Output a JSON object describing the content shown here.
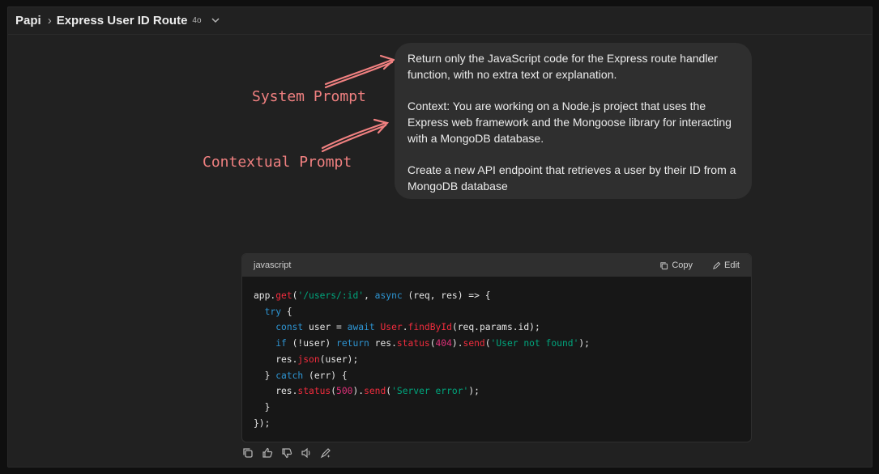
{
  "header": {
    "workspace": "Papi",
    "chat_title": "Express User ID Route",
    "model_badge": "4o"
  },
  "user_message": {
    "para1": "Return only the JavaScript code for the Express route handler function, with no extra text or explanation.",
    "para2": "Context: You are working on a Node.js project that uses the Express web framework and the Mongoose library for interacting with a MongoDB database.",
    "para3": "Create a new API endpoint that retrieves a user by their ID from a MongoDB database"
  },
  "annotations": {
    "system": "System Prompt",
    "contextual": "Contextual Prompt",
    "color": "#f08080"
  },
  "code_block": {
    "language": "javascript",
    "copy_label": "Copy",
    "edit_label": "Edit",
    "lines": [
      "app.get('/users/:id', async (req, res) => {",
      "  try {",
      "    const user = await User.findById(req.params.id);",
      "    if (!user) return res.status(404).send('User not found');",
      "    res.json(user);",
      "  } catch (err) {",
      "    res.status(500).send('Server error');",
      "  }",
      "});"
    ]
  },
  "message_actions": [
    "copy-icon",
    "thumbs-up-icon",
    "thumbs-down-icon",
    "read-aloud-icon",
    "regenerate-icon"
  ],
  "colors": {
    "background": "#212121",
    "bubble": "#2f2f2f",
    "code_bg": "#171717",
    "keyword": "#2e95d3",
    "function": "#f22c3d",
    "string": "#00a67d",
    "number": "#df3079"
  }
}
